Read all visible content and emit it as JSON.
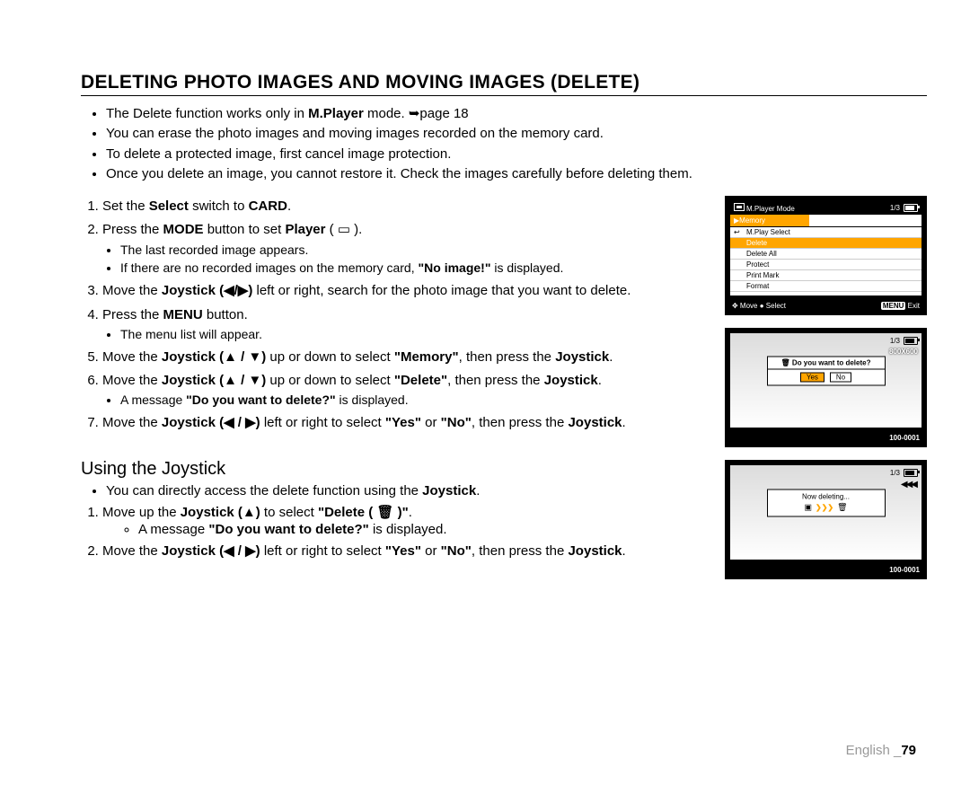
{
  "page": {
    "heading": "DELETING PHOTO IMAGES AND MOVING IMAGES (DELETE)",
    "footer_language": "English _",
    "footer_page": "79"
  },
  "intro_bullets": {
    "b1_pre": "The Delete function works only in ",
    "b1_bold": "M.Player",
    "b1_post": " mode. ➥page 18",
    "b2": "You can erase the photo images and moving images recorded on the memory card.",
    "b3": "To delete a protected image, first cancel image protection.",
    "b4": "Once you delete an image, you cannot restore it. Check the images carefully before deleting them."
  },
  "steps": {
    "s1_pre": "Set the ",
    "s1_b1": "Select",
    "s1_mid": " switch to ",
    "s1_b2": "CARD",
    "s1_post": ".",
    "s2_pre": "Press the ",
    "s2_b1": "MODE",
    "s2_mid": " button to set ",
    "s2_b2": "Player",
    "s2_post": " ( ▭ ).",
    "s2_sub1": "The last recorded image appears.",
    "s2_sub2_pre": "If there are no recorded images on the memory card, ",
    "s2_sub2_b": "\"No image!\"",
    "s2_sub2_post": " is displayed.",
    "s3_pre": "Move the ",
    "s3_b1": "Joystick (◀/▶)",
    "s3_post": " left or right, search for the photo image that you want to delete.",
    "s4_pre": "Press the ",
    "s4_b1": "MENU",
    "s4_post": " button.",
    "s4_sub1": "The menu list will appear.",
    "s5_pre": "Move the ",
    "s5_b1": "Joystick (▲ / ▼)",
    "s5_mid": " up or down to select ",
    "s5_b2": "\"Memory\"",
    "s5_post": ", then press the ",
    "s5_b3": "Joystick",
    "s5_end": ".",
    "s6_pre": "Move the ",
    "s6_b1": "Joystick (▲ / ▼)",
    "s6_mid": " up or down to select ",
    "s6_b2": "\"Delete\"",
    "s6_post": ", then press the ",
    "s6_b3": "Joystick",
    "s6_end": ".",
    "s6_sub1_pre": "A message ",
    "s6_sub1_b": "\"Do you want to delete?\"",
    "s6_sub1_post": " is displayed.",
    "s7_pre": "Move the ",
    "s7_b1": "Joystick (◀ / ▶)",
    "s7_mid": " left or right to select ",
    "s7_b2": "\"Yes\"",
    "s7_or": " or ",
    "s7_b3": "\"No\"",
    "s7_post": ", then press the ",
    "s7_b4": "Joystick",
    "s7_end": "."
  },
  "joystick": {
    "heading": "Using the Joystick",
    "note_pre": "You can directly access the delete function using the ",
    "note_b": "Joystick",
    "note_end": ".",
    "j1_pre": "Move up the ",
    "j1_b1": "Joystick (▲)",
    "j1_mid": " to select ",
    "j1_b2": "\"Delete ( 🗑 )\"",
    "j1_end": ".",
    "j1_sub_pre": "A message ",
    "j1_sub_b": "\"Do you want to delete?\"",
    "j1_sub_post": " is displayed.",
    "j2_pre": "Move the ",
    "j2_b1": "Joystick (◀ / ▶)",
    "j2_mid": " left or right to select ",
    "j2_b2": "\"Yes\"",
    "j2_or": " or ",
    "j2_b3": "\"No\"",
    "j2_post": ", then press the ",
    "j2_b4": "Joystick",
    "j2_end": "."
  },
  "screens": {
    "s1": {
      "mode": "M.Player Mode",
      "counter": "1/3",
      "memory": "▶Memory",
      "menu": [
        "M.Play Select",
        "Delete",
        "Delete All",
        "Protect",
        "Print Mark",
        "Format"
      ],
      "highlighted_index": 1,
      "footer_move": "✥ Move  ● Select",
      "footer_menu": "MENU",
      "footer_exit": "Exit"
    },
    "s2": {
      "counter": "1/3",
      "resolution": "800X600",
      "question": "🗑 Do you want to delete?",
      "yes": "Yes",
      "no": "No",
      "index": "100-0001"
    },
    "s3": {
      "counter": "1/3",
      "rev": "◀◀◀",
      "text": "Now deleting...",
      "index": "100-0001"
    }
  }
}
